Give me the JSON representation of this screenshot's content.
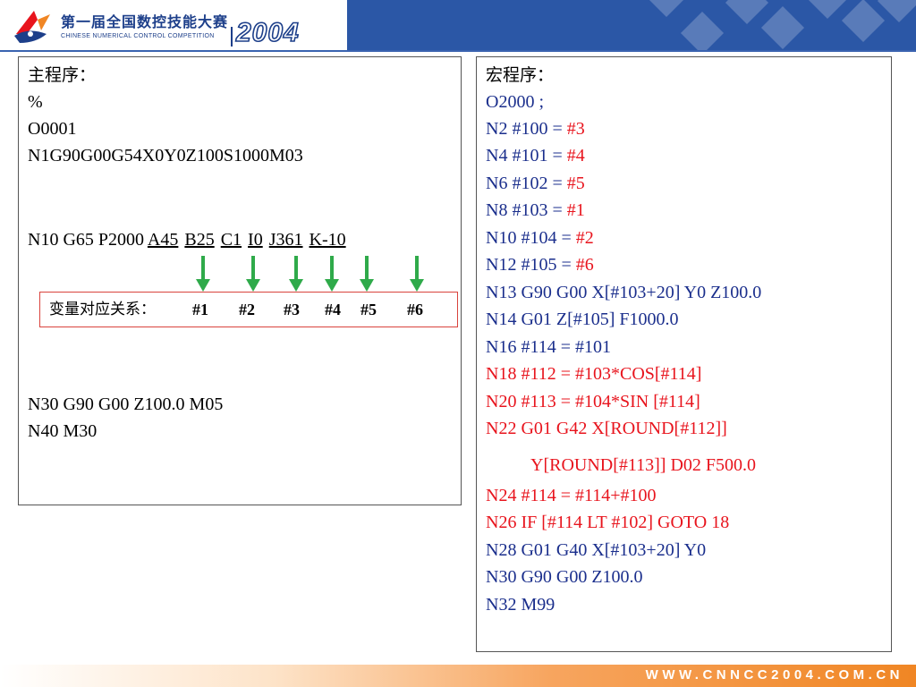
{
  "header": {
    "title": "第一届全国数控技能大赛",
    "subtitle": "CHINESE NUMERICAL CONTROL COMPETITION",
    "year": "2004"
  },
  "main_program": {
    "lines": [
      "主程序：",
      "%",
      "O0001",
      "N1G90G00G54X0Y0Z100S1000M03"
    ],
    "call_line": {
      "prefix": "N10 G65 P2000 ",
      "args": [
        "A45",
        "B25",
        "C1",
        "I0",
        "J361",
        "K-10"
      ]
    },
    "end_lines": [
      "N30 G90 G00 Z100.0 M05",
      "N40 M30"
    ]
  },
  "variable_mapping": {
    "label": "变量对应关系：",
    "vars": [
      "#1",
      "#2",
      "#3",
      "#4",
      "#5",
      "#6"
    ]
  },
  "macro_program": {
    "title": "宏程序：",
    "lines": [
      {
        "text": "O2000 ;",
        "color": "blue"
      },
      {
        "pre": "N2 #100 = ",
        "val": "#3"
      },
      {
        "pre": "N4 #101 = ",
        "val": "#4"
      },
      {
        "pre": "N6 #102 = ",
        "val": "#5"
      },
      {
        "pre": "N8 #103 = ",
        "val": "#1"
      },
      {
        "pre": "N10 #104 = ",
        "val": "#2"
      },
      {
        "pre": "N12 #105 = ",
        "val": "#6"
      },
      {
        "text": "N13 G90 G00 X[#103+20] Y0 Z100.0",
        "color": "blue"
      },
      {
        "text": "N14 G01 Z[#105] F1000.0",
        "color": "blue"
      },
      {
        "text": "N16 #114 = #101",
        "color": "blue"
      },
      {
        "text": "N18 #112 = #103*COS[#114]",
        "color": "red"
      },
      {
        "text": "N20 #113 = #104*SIN [#114]",
        "color": "red"
      },
      {
        "text": "N22 G01 G42 X[ROUND[#112]]",
        "color": "red"
      },
      {
        "text": "Y[ROUND[#113]] D02 F500.0",
        "color": "red"
      },
      {
        "text": "N24 #114 = #114+#100",
        "color": "red"
      },
      {
        "text": "N26 IF [#114 LT #102] GOTO 18",
        "color": "red"
      },
      {
        "text": "N28 G01 G40 X[#103+20] Y0",
        "color": "blue"
      },
      {
        "text": "N30 G90 G00 Z100.0",
        "color": "blue"
      },
      {
        "text": "N32 M99",
        "color": "blue"
      }
    ]
  },
  "footer": {
    "url": "WWW.CNNCC2004.COM.CN"
  },
  "colors": {
    "header_blue": "#2b57a6",
    "code_blue": "#1a2e8c",
    "code_red": "#e8141d",
    "arrow_green": "#2faa4a",
    "footer_orange": "#f08624"
  }
}
